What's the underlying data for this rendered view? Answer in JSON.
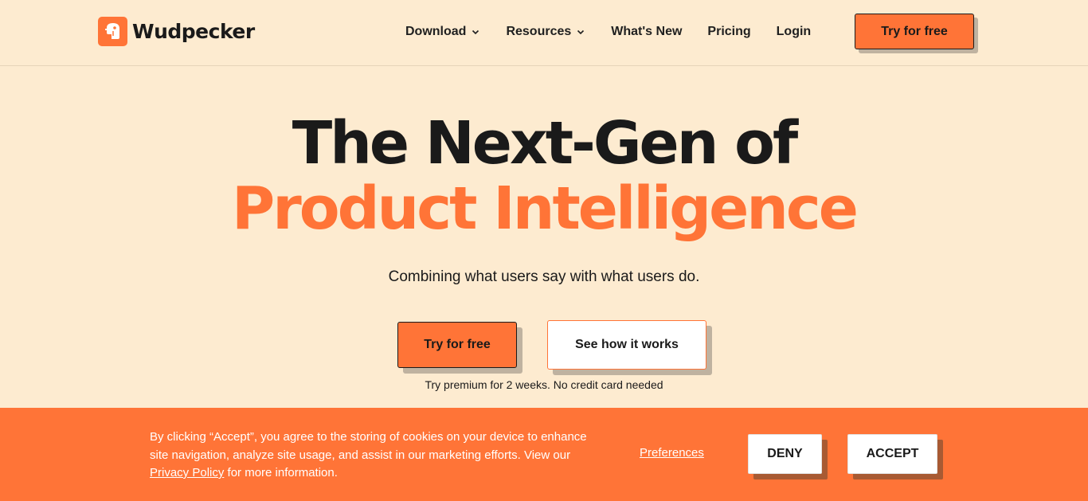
{
  "header": {
    "brand": "Wudpecker",
    "nav": [
      {
        "label": "Download",
        "has_dropdown": true
      },
      {
        "label": "Resources",
        "has_dropdown": true
      },
      {
        "label": "What's New",
        "has_dropdown": false
      },
      {
        "label": "Pricing",
        "has_dropdown": false
      },
      {
        "label": "Login",
        "has_dropdown": false
      }
    ],
    "cta_label": "Try for free"
  },
  "hero": {
    "title_line1": "The Next-Gen of",
    "title_line2": "Product Intelligence",
    "subtitle": "Combining what users say with what users do.",
    "primary_cta": "Try for free",
    "secondary_cta": "See how it works",
    "note": "Try premium for 2 weeks. No credit card needed"
  },
  "cookie_banner": {
    "text_before_link": "By clicking “Accept”, you agree to the storing of cookies on your device to enhance site navigation, analyze site usage, and assist in our marketing efforts. View our ",
    "link_label": "Privacy Policy",
    "text_after_link": " for more information.",
    "preferences_label": "Preferences",
    "deny_label": "DENY",
    "accept_label": "ACCEPT"
  },
  "colors": {
    "background": "#fdebd0",
    "accent": "#ff7437",
    "text": "#1a1a1a"
  },
  "icons": {
    "logo": "woodpecker-logo-icon",
    "dropdown": "chevron-down-icon"
  }
}
